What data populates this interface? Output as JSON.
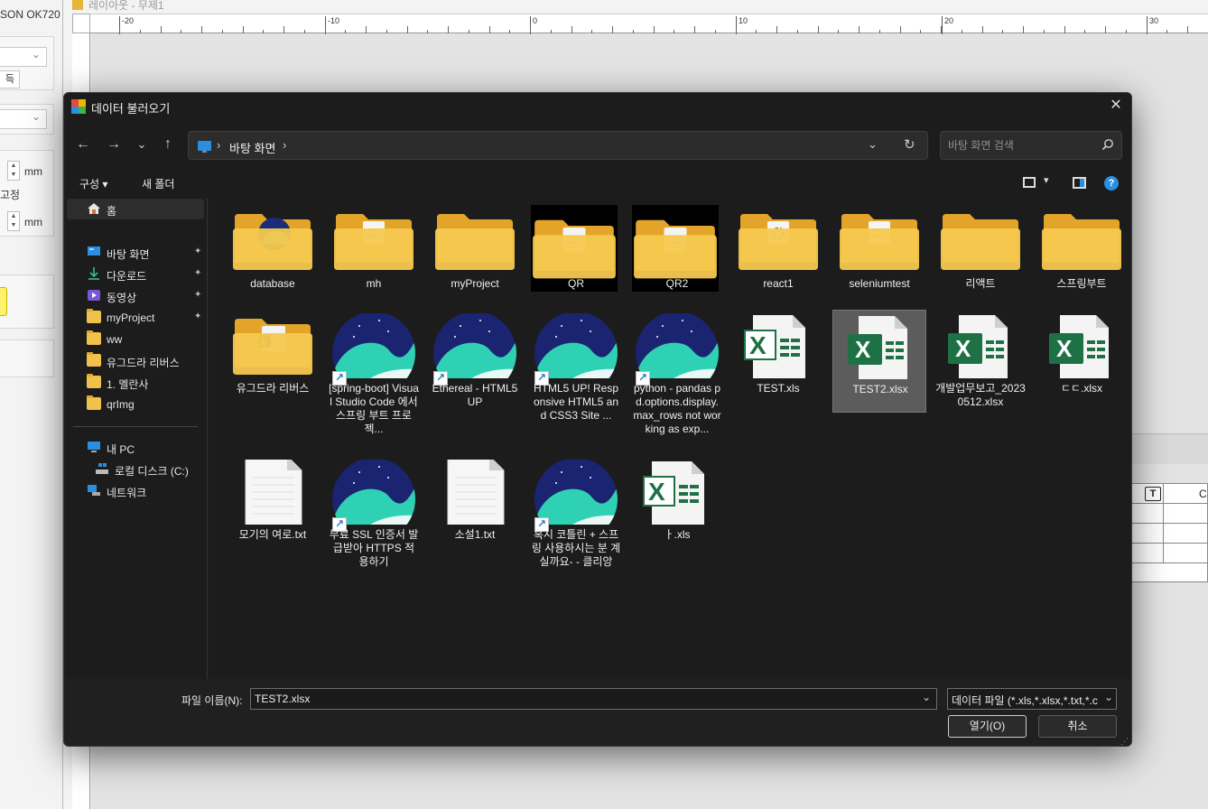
{
  "background": {
    "printer_name": "SON OK720",
    "btn_label": "득",
    "mm1": "mm",
    "fix_label": "고정",
    "mm2": "mm",
    "canvas_title": "레이아웃 - 무제1",
    "ruler_labels": [
      "-20",
      "-10",
      "0",
      "10",
      "20",
      "30"
    ],
    "table_icon": "T",
    "table_col": "C"
  },
  "dialog": {
    "title": "데이터 불러오기",
    "close": "✕",
    "nav": {
      "back": "←",
      "forward": "→",
      "recent": "⌄",
      "up": "↑"
    },
    "address": {
      "sep": "›",
      "location": "바탕 화면",
      "dropdown": "⌄",
      "refresh": "↻"
    },
    "search": {
      "placeholder": "바탕 화면 검색"
    },
    "toolbar": {
      "organize": "구성 ▾",
      "new_folder": "새 폴더",
      "view_dd": "▾",
      "help": "?"
    },
    "sidebar": {
      "home": "홈",
      "quick": [
        {
          "label": "바탕 화면",
          "icon": "desktop-icon",
          "pinned": true
        },
        {
          "label": "다운로드",
          "icon": "download-icon",
          "pinned": true
        },
        {
          "label": "동영상",
          "icon": "video-icon",
          "pinned": true
        },
        {
          "label": "myProject",
          "icon": "folder-icon",
          "pinned": true
        },
        {
          "label": "ww",
          "icon": "folder-icon",
          "pinned": false
        },
        {
          "label": "유그드라 리버스",
          "icon": "folder-icon",
          "pinned": false
        },
        {
          "label": "1. 멜란사",
          "icon": "folder-icon",
          "pinned": false
        },
        {
          "label": "qrImg",
          "icon": "folder-icon",
          "pinned": false
        }
      ],
      "pin": "📌",
      "this_pc": "내 PC",
      "local_disk": "로컬 디스크 (C:)",
      "network": "네트워크"
    },
    "files": [
      {
        "name": "database",
        "type": "folder-whale"
      },
      {
        "name": "mh",
        "type": "folder-doc"
      },
      {
        "name": "myProject",
        "type": "folder"
      },
      {
        "name": "QR",
        "type": "folder-doc-black"
      },
      {
        "name": "QR2",
        "type": "folder-doc-black"
      },
      {
        "name": "react1",
        "type": "folder-gear"
      },
      {
        "name": "seleniumtest",
        "type": "folder-doc"
      },
      {
        "name": "리액트",
        "type": "folder"
      },
      {
        "name": "스프링부트",
        "type": "folder"
      },
      {
        "name": "유그드라 리버스",
        "type": "folder-excel"
      },
      {
        "name": "[spring-boot] Visual Studio Code 에서 스프링 부트 프로젝...",
        "type": "whale-link"
      },
      {
        "name": "Ethereal - HTML5 UP",
        "type": "whale-link"
      },
      {
        "name": "HTML5 UP! Responsive HTML5 and CSS3 Site ...",
        "type": "whale-link"
      },
      {
        "name": "python - pandas pd.options.display.max_rows not working as exp...",
        "type": "whale-link"
      },
      {
        "name": "TEST.xls",
        "type": "excel-old"
      },
      {
        "name": "TEST2.xlsx",
        "type": "excel",
        "selected": true
      },
      {
        "name": "개발업무보고_20230512.xlsx",
        "type": "excel"
      },
      {
        "name": "ㄷㄷ.xlsx",
        "type": "excel"
      },
      {
        "name": "모기의 여로.txt",
        "type": "txt"
      },
      {
        "name": "무료 SSL 인증서 발급받아 HTTPS 적용하기",
        "type": "whale-link"
      },
      {
        "name": "소설1.txt",
        "type": "txt"
      },
      {
        "name": "혹시 코틀린 + 스프링 사용하시는 분 계실까요- - 클리앙",
        "type": "whale-link"
      },
      {
        "name": "ㅏ.xls",
        "type": "excel-old"
      }
    ],
    "bottom": {
      "filename_label": "파일 이름(N):",
      "filename_value": "TEST2.xlsx",
      "filetype": "데이터 파일 (*.xls,*.xlsx,*.txt,*.c",
      "dropdown": "⌄",
      "open": "열기(O)",
      "cancel": "취소"
    },
    "colors": {
      "accent": "#2a8fe0",
      "excel_green": "#1e7145",
      "folder": "#f2c14b"
    }
  }
}
